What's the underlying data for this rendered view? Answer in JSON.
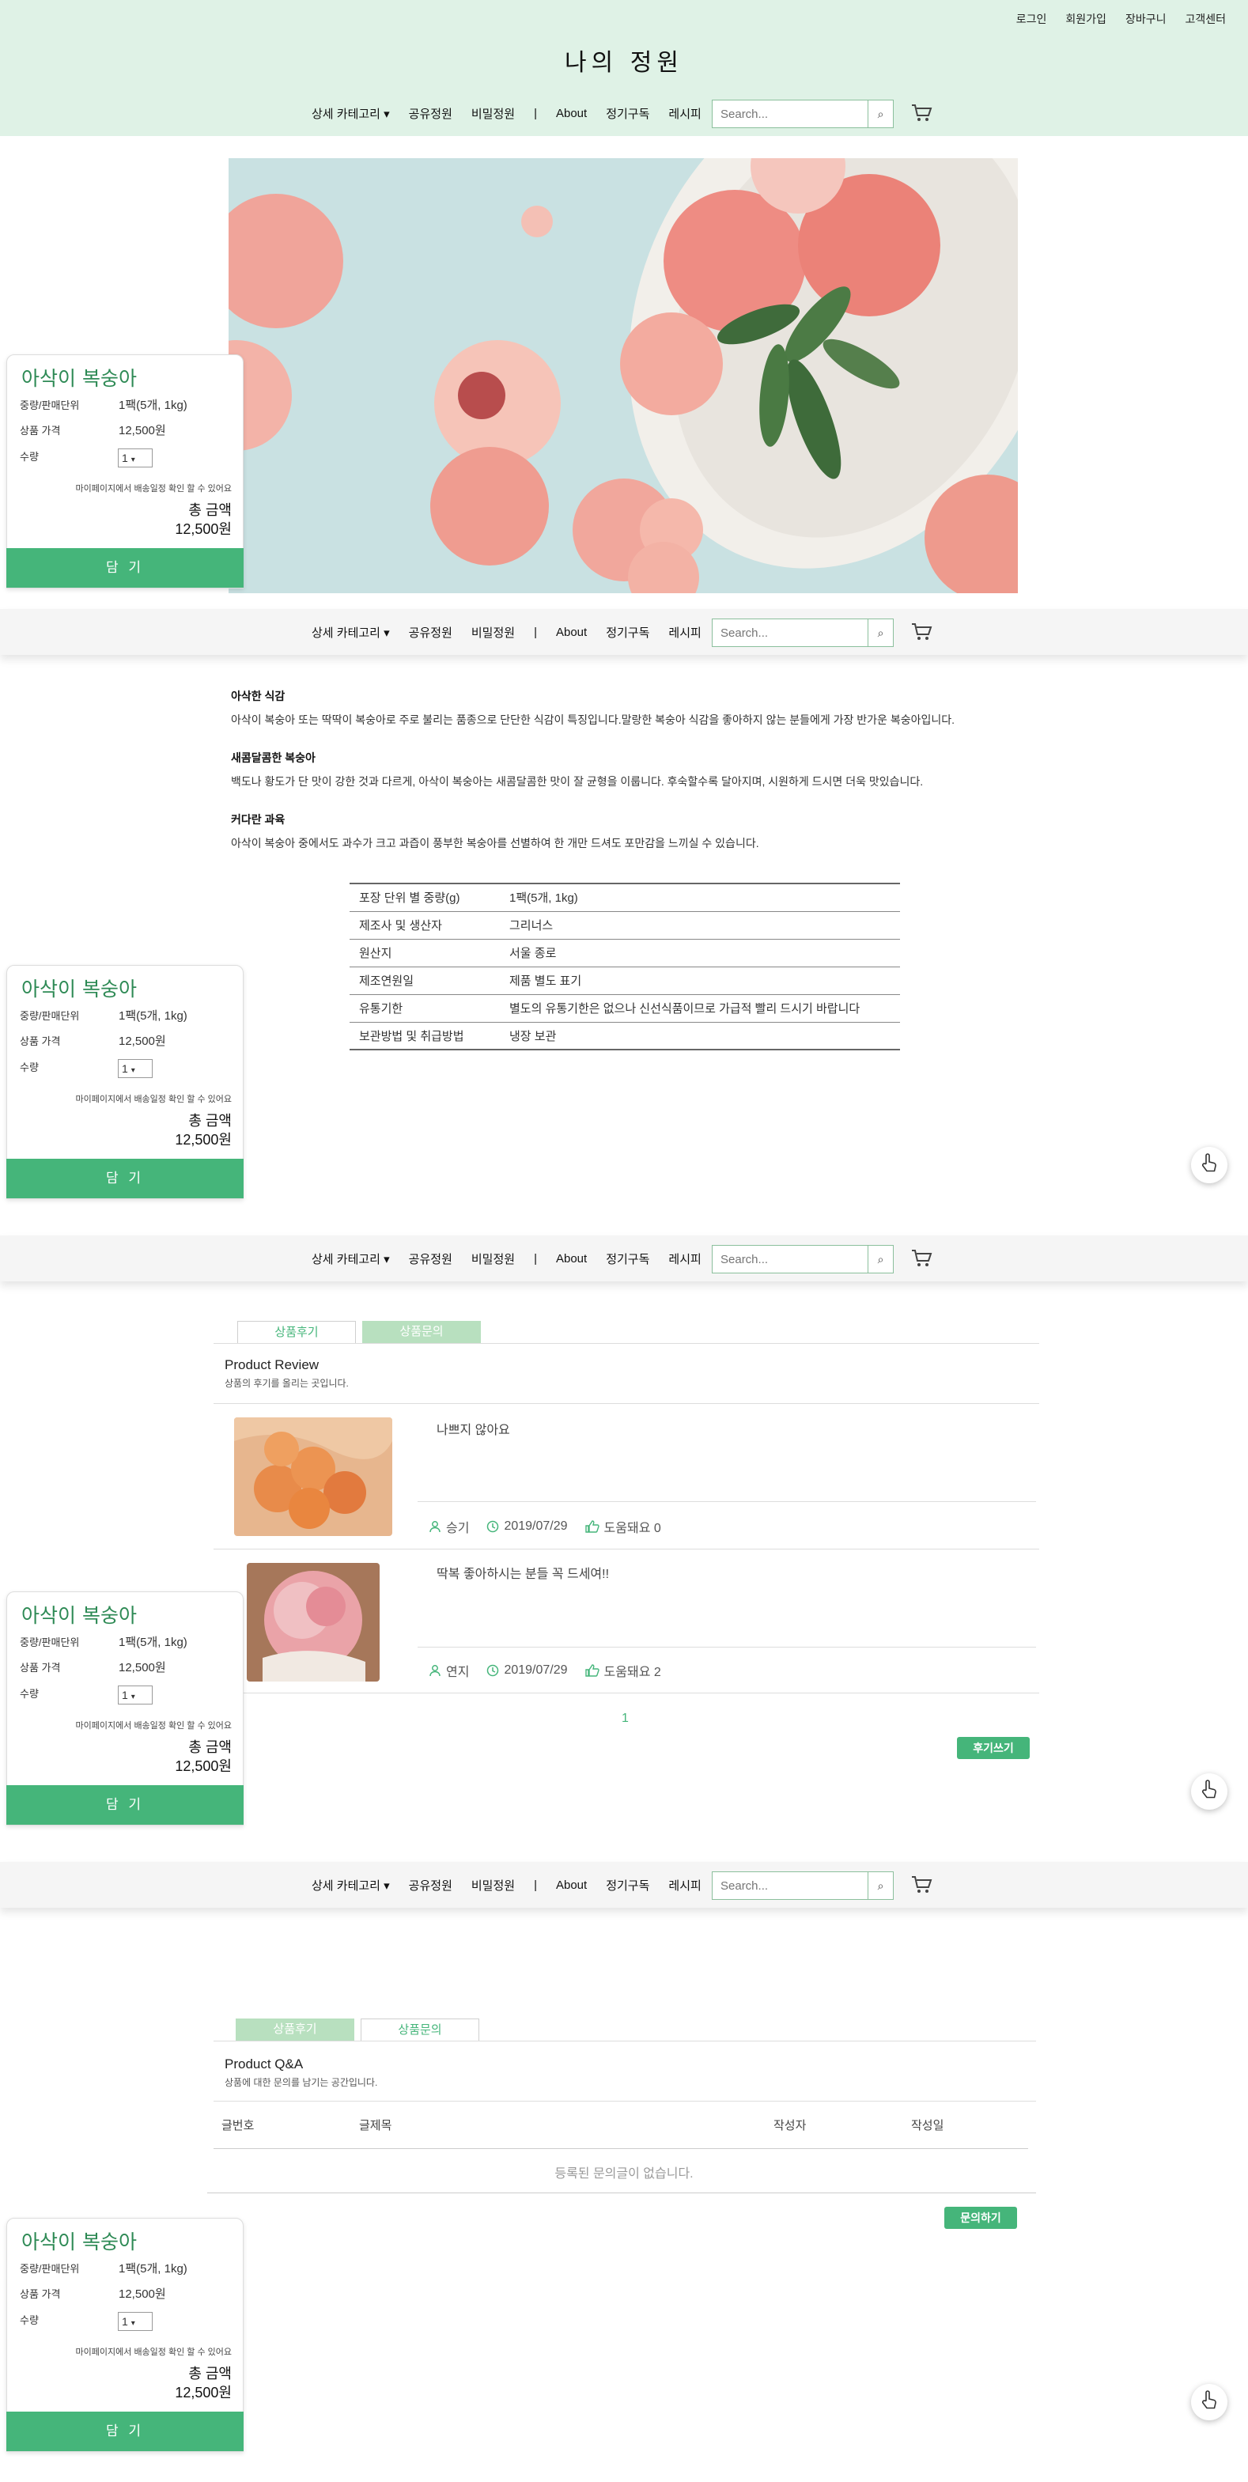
{
  "header": {
    "top_links": [
      "로그인",
      "회원가입",
      "장바구니",
      "고객센터"
    ],
    "site_title": "나의 정원",
    "bg_color": "#dff2e6"
  },
  "nav": {
    "category": "상세 카테고리",
    "items": [
      "공유정원",
      "비밀정원",
      "About",
      "정기구독",
      "레시피"
    ],
    "separator": "|",
    "search_placeholder": "Search...",
    "search_icon": "search-icon",
    "cart_icon": "cart-icon"
  },
  "product": {
    "name": "아삭이 복숭아",
    "unit_label": "중량/판매단위",
    "unit_value": "1팩(5개, 1kg)",
    "price_label": "상품 가격",
    "price_value": "12,500원",
    "qty_label": "수량",
    "qty_value": "1",
    "note": "마이페이지에서 배송일정 확인 할 수 있어요",
    "total_label": "총 금액",
    "total_value": "12,500원",
    "add_button": "담 기",
    "accent_color": "#45b57a"
  },
  "description": [
    {
      "title": "아삭한 식감",
      "body": "아삭이 복숭아 또는 딱딱이 복숭아로 주로 불리는 품종으로 단단한 식감이 특징입니다.말랑한 복숭아 식감을 좋아하지 않는 분들에게 가장 반가운 복숭아입니다."
    },
    {
      "title": "새콤달콤한 복숭아",
      "body": "백도나 황도가 단 맛이 강한 것과 다르게, 아삭이 복숭아는 새콤달콤한 맛이 잘 균형을 이룹니다. 후숙할수록 달아지며, 시원하게 드시면 더욱 맛있습니다."
    },
    {
      "title": "커다란 과육",
      "body": "아삭이 복숭아 중에서도 과수가 크고 과즙이 풍부한 복숭아를 선별하여 한 개만 드셔도 포만감을 느끼실 수 있습니다."
    }
  ],
  "info_table": [
    {
      "key": "포장 단위 별 중량(g)",
      "value": "1팩(5개, 1kg)"
    },
    {
      "key": "제조사 및 생산자",
      "value": "그리너스"
    },
    {
      "key": "원산지",
      "value": "서울 종로"
    },
    {
      "key": "제조연원일",
      "value": "제품 별도 표기"
    },
    {
      "key": "유통기한",
      "value": "별도의 유통기한은 없으나 신선식품이므로 가급적 빨리 드시기 바랍니다"
    },
    {
      "key": "보관방법 및 취급방법",
      "value": "냉장 보관"
    }
  ],
  "tabs": {
    "review": "상품후기",
    "qna": "상품문의"
  },
  "reviews_section": {
    "title": "Product Review",
    "subtitle": "상품의 후기를 올리는 곳입니다.",
    "items": [
      {
        "text": "나쁘지 않아요",
        "author": "승기",
        "date": "2019/07/29",
        "helpful": "도움돼요 0"
      },
      {
        "text": "딱복 좋아하시는 분들 꼭 드세여!!",
        "author": "연지",
        "date": "2019/07/29",
        "helpful": "도움돼요 2"
      }
    ],
    "page": "1",
    "write_button": "후기쓰기"
  },
  "qna_section": {
    "title": "Product Q&A",
    "subtitle": "상품에 대한 문의를 남기는 공간입니다.",
    "columns": [
      "글번호",
      "글제목",
      "작성자",
      "작성일"
    ],
    "empty": "등록된 문의글이 없습니다.",
    "ask_button": "문의하기"
  }
}
